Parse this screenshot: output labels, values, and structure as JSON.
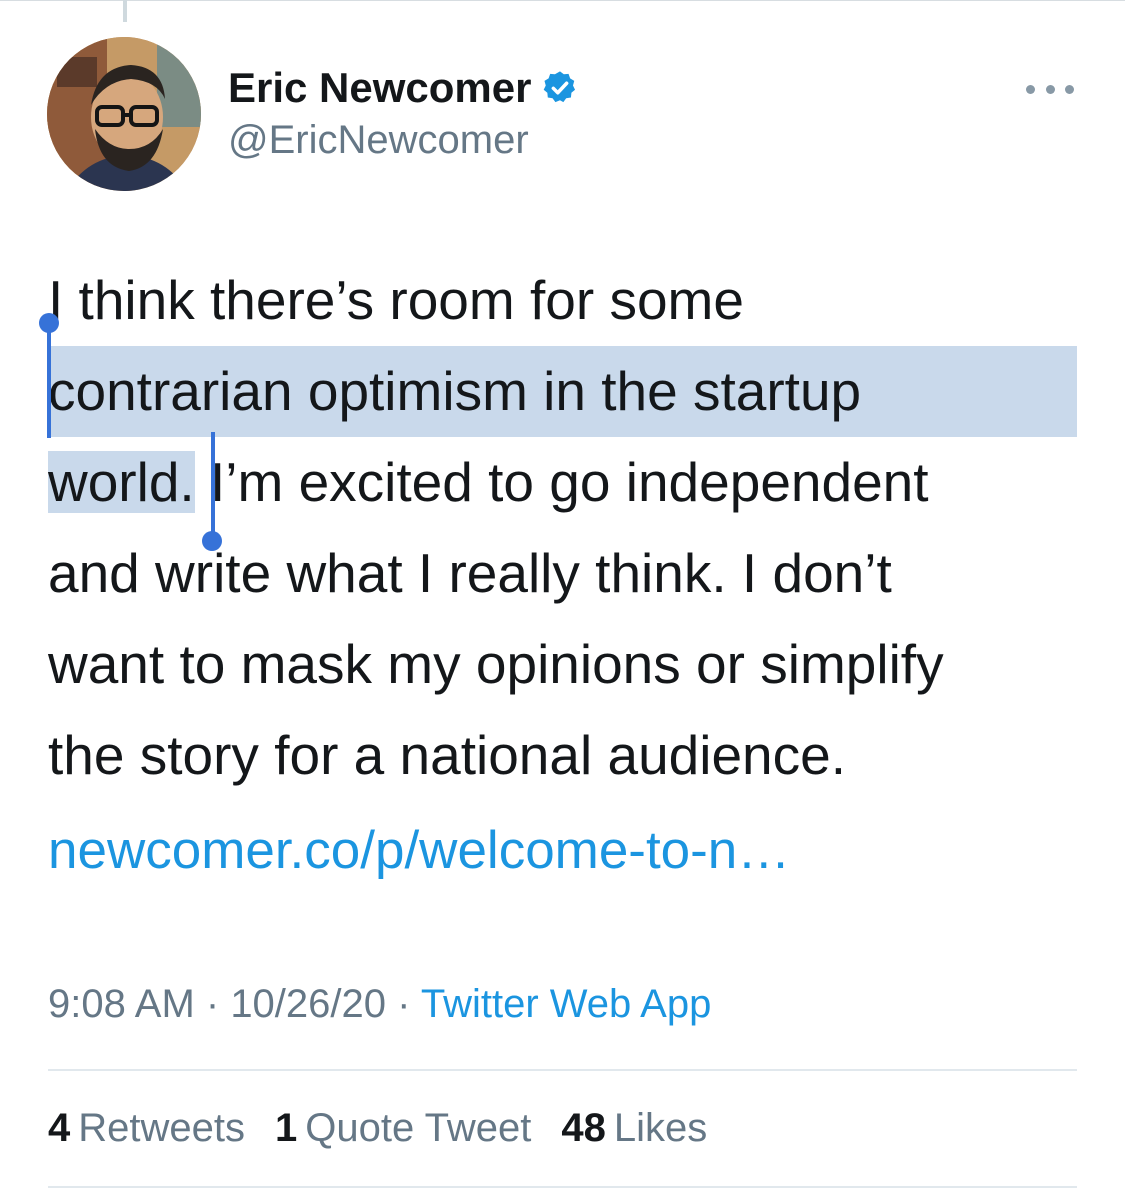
{
  "tweet": {
    "author": {
      "display_name": "Eric Newcomer",
      "handle": "@EricNewcomer",
      "verified": true
    },
    "text_lines": [
      {
        "pre": "I think there’s room for some",
        "sel": "",
        "post": ""
      },
      {
        "pre": "",
        "sel": "contrarian optimism in the startup",
        "post": ""
      },
      {
        "pre": "",
        "sel": "world.",
        "post": " I’m excited to go independent"
      },
      {
        "pre": "and write what I really think. I don’t",
        "sel": "",
        "post": ""
      },
      {
        "pre": "want to mask my opinions or simplify",
        "sel": "",
        "post": ""
      },
      {
        "pre": "the story for a national audience.",
        "sel": "",
        "post": ""
      }
    ],
    "link": "newcomer.co/p/welcome-to-n…",
    "time": "9:08 AM",
    "date": "10/26/20",
    "separator": " · ",
    "source": "Twitter Web App",
    "stats": {
      "retweets_count": "4",
      "retweets_label": "Retweets",
      "quotes_count": "1",
      "quotes_label": "Quote Tweet",
      "likes_count": "48",
      "likes_label": "Likes"
    }
  },
  "colors": {
    "link": "#1b95e0",
    "selection": "#c9d9eb",
    "selection_handle": "#3672d8",
    "secondary_text": "#657786"
  },
  "icons": {
    "verified": "verified-badge-icon",
    "more": "more-dots-icon"
  }
}
